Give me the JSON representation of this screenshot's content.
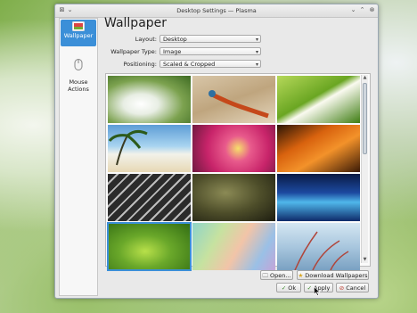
{
  "window": {
    "title": "Desktop Settings — Plasma"
  },
  "sidebar": {
    "items": [
      {
        "label": "Wallpaper",
        "active": true
      },
      {
        "label": "Mouse\nActions",
        "active": false
      }
    ]
  },
  "main": {
    "heading": "Wallpaper",
    "fields": [
      {
        "label": "Layout:",
        "value": "Desktop"
      },
      {
        "label": "Wallpaper Type:",
        "value": "Image"
      },
      {
        "label": "Positioning:",
        "value": "Scaled & Cropped"
      }
    ],
    "thumbnails": [
      {
        "name": "white-flower"
      },
      {
        "name": "lizard-on-sand"
      },
      {
        "name": "green-leaf-curve"
      },
      {
        "name": "palm-beach"
      },
      {
        "name": "pink-flower-petals"
      },
      {
        "name": "orange-leaf-macro"
      },
      {
        "name": "keyboard-keys"
      },
      {
        "name": "dewy-leaf"
      },
      {
        "name": "blue-aurora"
      },
      {
        "name": "green-bokeh-leaves"
      },
      {
        "name": "abstract-pastel"
      },
      {
        "name": "frosty-grass"
      }
    ]
  },
  "buttons": {
    "open": "Open...",
    "download": "Download Wallpapers",
    "ok": "Ok",
    "apply": "Apply",
    "cancel": "Cancel"
  },
  "colors": {
    "accent": "#3b8fd8"
  }
}
